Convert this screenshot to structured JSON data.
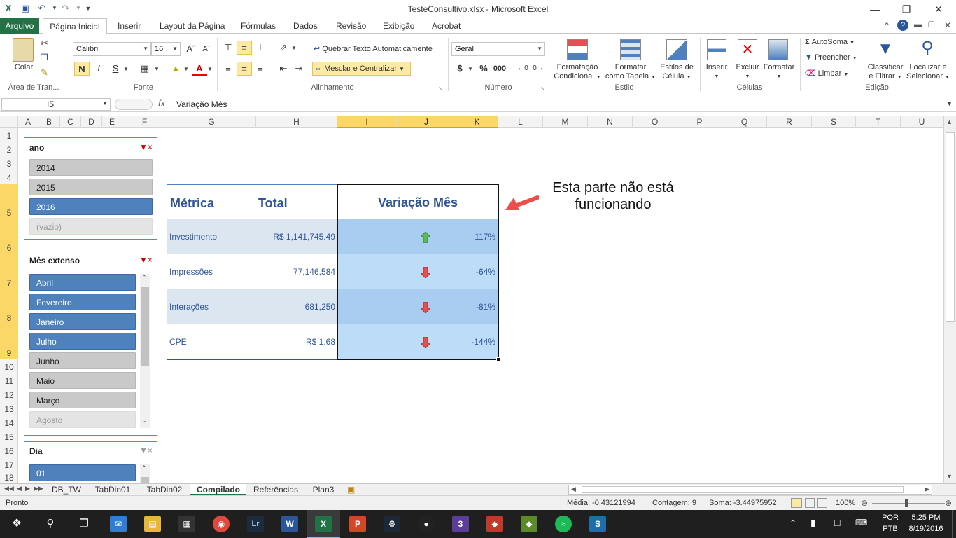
{
  "window": {
    "title": "TesteConsultivo.xlsx - Microsoft Excel"
  },
  "tabs": [
    "Arquivo",
    "Página Inicial",
    "Inserir",
    "Layout da Página",
    "Fórmulas",
    "Dados",
    "Revisão",
    "Exibição",
    "Acrobat"
  ],
  "ribbon": {
    "clipboard": {
      "paste": "Colar",
      "group": "Área de Tran..."
    },
    "font": {
      "name": "Calibri",
      "size": "16",
      "bold": "N",
      "italic": "I",
      "underline": "S",
      "group": "Fonte"
    },
    "alignment": {
      "wrap": "Quebrar Texto Automaticamente",
      "merge": "Mesclar e Centralizar",
      "group": "Alinhamento"
    },
    "number": {
      "format": "Geral",
      "currency": "$",
      "percent": "%",
      "thousands": "000",
      "group": "Número"
    },
    "styles": {
      "conditional": "Formatação",
      "conditional2": "Condicional",
      "as_table": "Formatar",
      "as_table2": "como Tabela",
      "cell_styles": "Estilos de",
      "cell_styles2": "Célula",
      "group": "Estilo"
    },
    "cells": {
      "insert": "Inserir",
      "delete": "Excluir",
      "format": "Formatar",
      "group": "Células"
    },
    "editing": {
      "autosum": "AutoSoma",
      "fill": "Preencher",
      "clear": "Limpar",
      "sort": "Classificar",
      "sort2": "e Filtrar",
      "find": "Localizar e",
      "find2": "Selecionar",
      "group": "Edição"
    }
  },
  "formula_bar": {
    "name_box": "I5",
    "fx": "fx",
    "content": "Variação Mês"
  },
  "columns": [
    "A",
    "B",
    "C",
    "D",
    "E",
    "F",
    "G",
    "H",
    "I",
    "J",
    "K",
    "L",
    "M",
    "N",
    "O",
    "P",
    "Q",
    "R",
    "S",
    "T",
    "U"
  ],
  "rows": [
    "1",
    "2",
    "3",
    "4",
    "5",
    "6",
    "7",
    "8",
    "9",
    "10",
    "11",
    "12",
    "13",
    "14",
    "15",
    "16",
    "17",
    "18"
  ],
  "slicers": {
    "ano": {
      "title": "ano",
      "items": [
        {
          "label": "2014",
          "state": "off"
        },
        {
          "label": "2015",
          "state": "off"
        },
        {
          "label": "2016",
          "state": "on"
        },
        {
          "label": "(vazio)",
          "state": "empty"
        }
      ]
    },
    "mes": {
      "title": "Mês extenso",
      "items": [
        {
          "label": "Abril",
          "state": "on"
        },
        {
          "label": "Fevereiro",
          "state": "on"
        },
        {
          "label": "Janeiro",
          "state": "on"
        },
        {
          "label": "Julho",
          "state": "on"
        },
        {
          "label": "Junho",
          "state": "off"
        },
        {
          "label": "Maio",
          "state": "off"
        },
        {
          "label": "Março",
          "state": "off"
        },
        {
          "label": "Agosto",
          "state": "empty"
        }
      ]
    },
    "dia": {
      "title": "Dia",
      "items": [
        {
          "label": "01",
          "state": "on"
        }
      ]
    }
  },
  "table": {
    "headers": {
      "metric": "Métrica",
      "total": "Total",
      "variation": "Variação Mês"
    },
    "rows": [
      {
        "metric": "Investimento",
        "total": "R$ 1,141,745.49",
        "trend": "up",
        "variation": "117%"
      },
      {
        "metric": "Impressões",
        "total": "77,146,584",
        "trend": "down",
        "variation": "-64%"
      },
      {
        "metric": "Interações",
        "total": "681,250",
        "trend": "down",
        "variation": "-81%"
      },
      {
        "metric": "CPE",
        "total": "R$ 1.68",
        "trend": "down",
        "variation": "-144%"
      }
    ],
    "colors": {
      "band_dark": "#dce6f1",
      "band_light": "#ffffff",
      "sel_dark": "#a9cdf0",
      "sel_light": "#bcdcf8",
      "up": "#5cb85c",
      "down": "#e05252"
    }
  },
  "annotation": {
    "line1": "Esta parte não está",
    "line2": "funcionando",
    "arrow_color": "#ef4c4c"
  },
  "sheets": [
    {
      "label": "DB_TW",
      "active": false
    },
    {
      "label": "TabDin01",
      "active": false
    },
    {
      "label": "TabDin02",
      "active": false
    },
    {
      "label": "Compilado",
      "active": true
    },
    {
      "label": "Referências",
      "active": false
    },
    {
      "label": "Plan3",
      "active": false
    }
  ],
  "status": {
    "ready": "Pronto",
    "average": "Média: -0.43121994",
    "count": "Contagem: 9",
    "sum": "Soma: -3.44975952",
    "zoom": "100%"
  },
  "taskbar": {
    "lang": "POR",
    "layout": "PTB",
    "time": "5:25 PM",
    "date": "8/19/2016"
  }
}
